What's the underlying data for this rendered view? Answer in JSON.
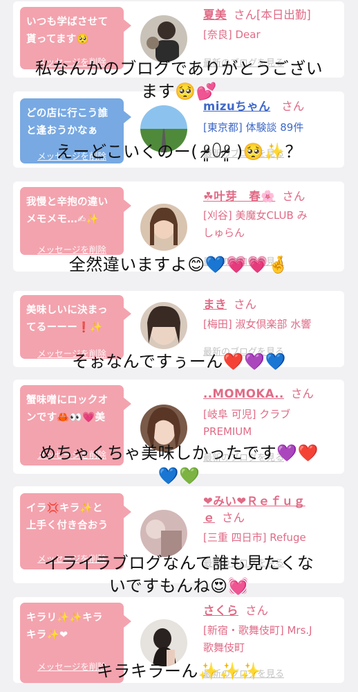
{
  "entries": [
    {
      "message": [
        "いつも学ばさせて",
        "貰ってます🥺"
      ],
      "delete_label": "メッセージを削除",
      "name": "夏美",
      "san": "さん",
      "shop": "[本日出勤]",
      "shop2": "[奈良] Dear",
      "shop3": "",
      "blog_label": "最新のブログを見る"
    },
    {
      "message": [
        "どの店に行こう誰",
        "と逢おうかなぁ"
      ],
      "delete_label": "メッセージを削除",
      "name": "mizuちゃん",
      "san": "さん",
      "shop": "[東京都] 体験談 89件",
      "shop2": "",
      "shop3": "",
      "blog_label": "最新のブログを見る"
    },
    {
      "message": [
        "我慢と辛抱の違い",
        "メモメモ…✍✨"
      ],
      "delete_label": "メッセージを削除",
      "name": "☘叶芽　春🌸",
      "san": "さん",
      "shop": "[刈谷] 美魔女CLUB み",
      "shop2": "しゅらん",
      "shop3": "",
      "blog_label": "最新のブログを見る"
    },
    {
      "message": [
        "美味しいに決まっ",
        "てるーーー❗️✨"
      ],
      "delete_label": "メッセージを削除",
      "name": "まき",
      "san": "さん",
      "shop": "[梅田] 淑女倶楽部 水響",
      "shop2": "",
      "shop3": "",
      "blog_label": "最新のブログを見る"
    },
    {
      "message": [
        "蟹味噌にロックオ",
        "ンです🦀👀💗美"
      ],
      "delete_label": "メッセージを削除",
      "name": "..MOMOKA..",
      "san": "さん",
      "shop": "[岐阜 可児] クラブ",
      "shop2": "PREMIUM",
      "shop3": "",
      "blog_label": "最新のブログを見る"
    },
    {
      "message": [
        "イラ💢キラ✨と",
        "上手く付き合おう"
      ],
      "delete_label": "メッセージを削除",
      "name": "❤みい❤Ｒｅｆｕｇ",
      "name2": "ｅ",
      "san": "さん",
      "shop": "[三重 四日市] Refuge",
      "shop2": "",
      "shop3": "",
      "blog_label": "最新のブログを見る"
    },
    {
      "message": [
        "キラリ✨✨キラ",
        "キラ✨❤"
      ],
      "delete_label": "メッセージを削除",
      "name": "さくら",
      "san": "さん",
      "shop": "[新宿・歌舞伎町] Mrs.J",
      "shop2": "歌舞伎町",
      "shop3": "",
      "blog_label": "最新のブログを見る"
    }
  ],
  "overlays": [
    {
      "lines": [
        "私なんかのブログでありがとうござい",
        "ます🥺💕"
      ]
    },
    {
      "lines": [
        "えーどこいくのー( ⁰̷̴͈꒨⁰̷̴͈ )🥺✨？"
      ]
    },
    {
      "lines": [
        "全然違いますよ😊💙💗💗🤞"
      ]
    },
    {
      "lines": [
        "そぉなんですぅーん❤️💜💙"
      ]
    },
    {
      "lines": [
        "めちゃくちゃ美味しかったです💜❤️",
        "💙💚"
      ]
    },
    {
      "lines": [
        "イライラブログなんて誰も見たくな",
        "いですもんね😍💓"
      ]
    },
    {
      "lines": [
        "キラキラーん✨✨✨"
      ]
    }
  ],
  "colors": {
    "pink_bubble": "#f3a3ae",
    "blue_bubble": "#78a9e2",
    "name_pink": "#e06b86",
    "name_blue": "#3e68c9",
    "link_gray": "#c3c3c3"
  },
  "icons": [
    "avatar-photo"
  ]
}
